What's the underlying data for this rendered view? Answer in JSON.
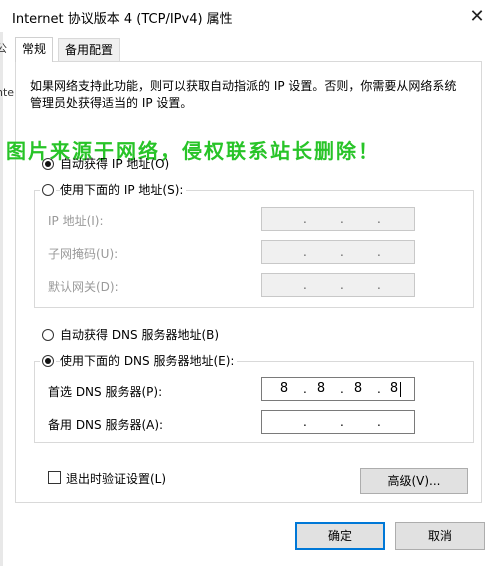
{
  "window": {
    "title": "Internet 协议版本 4 (TCP/IPv4) 属性",
    "close_glyph": "✕",
    "left_background_glyphs": [
      "公",
      "ntern"
    ]
  },
  "tabs": [
    {
      "label": "常规",
      "selected": true
    },
    {
      "label": "备用配置",
      "selected": false
    }
  ],
  "description": "如果网络支持此功能，则可以获取自动指派的 IP 设置。否则，你需要从网络系统管理员处获得适当的 IP 设置。",
  "watermark": "图片来源于网络，侵权联系站长删除！",
  "ip_section": {
    "auto_label": "自动获得 IP 地址(O)",
    "manual_label": "使用下面的 IP 地址(S):",
    "auto_selected": true,
    "fields": [
      {
        "label": "IP 地址(I):",
        "value": ". . ."
      },
      {
        "label": "子网掩码(U):",
        "value": ". . ."
      },
      {
        "label": "默认网关(D):",
        "value": ". . ."
      }
    ]
  },
  "dns_section": {
    "auto_label": "自动获得 DNS 服务器地址(B)",
    "manual_label": "使用下面的 DNS 服务器地址(E):",
    "manual_selected": true,
    "preferred": {
      "label": "首选 DNS 服务器(P):",
      "octets": [
        "8",
        "8",
        "8",
        "8"
      ]
    },
    "alternate": {
      "label": "备用 DNS 服务器(A):",
      "octets": [
        "",
        "",
        "",
        ""
      ]
    }
  },
  "validate_on_exit": {
    "label": "退出时验证设置(L)",
    "checked": false
  },
  "buttons": {
    "advanced": "高级(V)...",
    "ok": "确定",
    "cancel": "取消"
  },
  "colors": {
    "accent": "#0078d7",
    "watermark": "#28c428",
    "disabled_text": "#9a9a9a"
  }
}
